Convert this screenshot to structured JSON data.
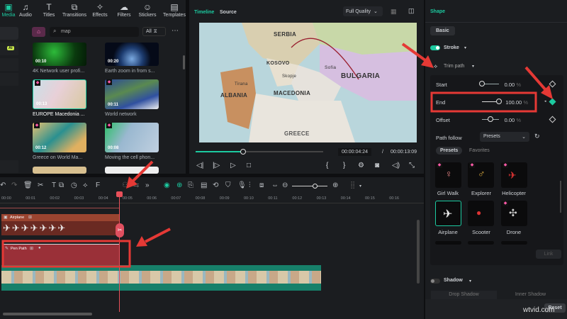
{
  "media_toolbar": {
    "items": [
      {
        "label": "Media",
        "icon": "media-icon",
        "active": true
      },
      {
        "label": "Audio",
        "icon": "music-note-icon"
      },
      {
        "label": "Titles",
        "icon": "text-t-icon"
      },
      {
        "label": "Transitions",
        "icon": "transitions-icon"
      },
      {
        "label": "Effects",
        "icon": "effects-star-icon"
      },
      {
        "label": "Filters",
        "icon": "filters-icon"
      },
      {
        "label": "Stickers",
        "icon": "stickers-icon"
      },
      {
        "label": "Templates",
        "icon": "templates-icon"
      }
    ]
  },
  "media_sidebar": {
    "ai_badge": "AI"
  },
  "search": {
    "value": "map",
    "filter": "All"
  },
  "media_items": [
    {
      "title": "4K Network user profi...",
      "duration": "00:10"
    },
    {
      "title": "Earth zoom in from s...",
      "duration": "00:20"
    },
    {
      "title": "EUROPE Macedonia ...",
      "duration": "00:13"
    },
    {
      "title": "World network",
      "duration": "00:11"
    },
    {
      "title": "Greece on World Ma...",
      "duration": "00:12"
    },
    {
      "title": "Moving the cell phon...",
      "duration": "00:08"
    }
  ],
  "preview": {
    "tabs": [
      "Timeline",
      "Source"
    ],
    "active_tab": "Timeline",
    "quality": "Full Quality",
    "map_labels": {
      "serbia": "SERBIA",
      "kosovo": "KOSOVO",
      "sofia": "Sofia",
      "bulgaria": "BULGARIA",
      "skopje": "Skopje",
      "tirana": "Tirana",
      "albania": "ALBANIA",
      "macedonia": "MACEDONIA",
      "greece": "GREECE"
    },
    "current_time": "00:00:04:24",
    "separator": "/",
    "total_time": "00:00:13:09",
    "progress": 0.37
  },
  "shape_panel": {
    "title": "Shape",
    "tab": "Basic",
    "stroke_label": "Stroke",
    "stroke_on": true,
    "trim_path_label": "Trim path",
    "start": {
      "label": "Start",
      "value": "0.00",
      "unit": "%",
      "fraction": 0
    },
    "end": {
      "label": "End",
      "value": "100.00",
      "unit": "%",
      "fraction": 1
    },
    "offset": {
      "label": "Offset",
      "value": "0.00",
      "unit": "%",
      "fraction": 0.5
    },
    "path_follow_label": "Path follow",
    "path_follow_value": "Presets",
    "preset_tabs": [
      "Presets",
      "Favorites"
    ],
    "presets": [
      "Girl Walk",
      "Explorer",
      "Helicopter",
      "Airplane",
      "Scooter",
      "Drone"
    ],
    "selected_preset": "Airplane",
    "link_label": "Link",
    "shadow_label": "Shadow",
    "shadow_on": false,
    "shadow_tabs": [
      "Drop Shadow",
      "Inner Shadow"
    ],
    "reset_label": "Reset"
  },
  "timeline": {
    "ruler": [
      "00:00",
      "00:01",
      "00:02",
      "00:03",
      "00:04",
      "00:05",
      "00:06",
      "00:07",
      "00:08",
      "00:09",
      "00:10",
      "00:11",
      "00:12",
      "00:13",
      "00:14",
      "00:15",
      "00:16"
    ],
    "tracks": [
      {
        "label": "Airplane"
      },
      {
        "label": "Pen Path"
      }
    ]
  },
  "watermark": "wtvid.com",
  "colors": {
    "accent": "#1ccaa0",
    "annotation": "#e53935",
    "clip_airplane": "#8a3a2a",
    "clip_pen": "#a0343a",
    "clip_video": "#1a7a66"
  }
}
